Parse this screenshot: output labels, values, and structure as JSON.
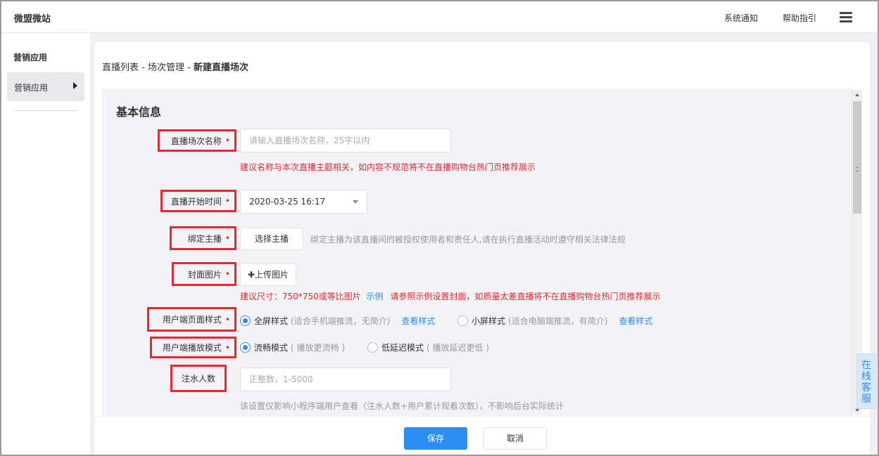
{
  "app": {
    "title": "微盟微站",
    "notify": "系统通知",
    "help": "帮助指引",
    "menu_icon": "hamburger-menu-icon"
  },
  "sidebar": {
    "heading": "营销应用",
    "items": [
      {
        "label": "营销应用",
        "icon": "caret-right-icon"
      }
    ]
  },
  "breadcrumb": {
    "item1": "直播列表",
    "sep": " - ",
    "item2": "场次管理",
    "current": "新建直播场次"
  },
  "form": {
    "section_title": "基本信息",
    "required_mark": "•",
    "name": {
      "label": "直播场次名称",
      "placeholder": "请输入直播场次名称，25字以内",
      "warning": "建议名称与本次直播主题相关，如内容不规范将不在直播购物台热门页推荐展示"
    },
    "start_time": {
      "label": "直播开始时间",
      "value": "2020-03-25 16:17"
    },
    "anchor": {
      "label": "绑定主播",
      "button": "选择主播",
      "hint": "绑定主播为该直播间的被授权使用者和责任人,请在执行直播活动时遵守相关法律法规"
    },
    "cover": {
      "label": "封面图片",
      "button": "✚上传图片",
      "warning_prefix": "建议尺寸：750*750或等比图片",
      "example_link": "示例",
      "warning_suffix": "请参照示例设置封面，如质量太差直播将不在直播购物台热门页推荐展示"
    },
    "page_style": {
      "label": "用户端页面样式",
      "options": [
        {
          "label": "全屏样式",
          "desc": "(适合手机端推流，无简介)",
          "link": "查看样式",
          "selected": true
        },
        {
          "label": "小屏样式",
          "desc": "(适合电脑端推流，有简介)",
          "link": "查看样式",
          "selected": false
        }
      ]
    },
    "play_mode": {
      "label": "用户端播放模式",
      "options": [
        {
          "label": "流畅模式",
          "desc": "( 播放更流畅 )",
          "selected": true
        },
        {
          "label": "低延迟模式",
          "desc": "( 播放延迟更低 )",
          "selected": false
        }
      ]
    },
    "inject": {
      "label": "注水人数",
      "placeholder": "正整数，1-5000",
      "hint": "该设置仅影响小程序端用户查看（注水人数+用户累计观看次数），不影响后台实际统计"
    }
  },
  "footer": {
    "save": "保存",
    "cancel": "取消"
  },
  "service": {
    "label": "在线客服"
  },
  "colors": {
    "primary": "#2d8cf0",
    "danger": "#e8262d",
    "panel": "#f2f3f6"
  }
}
